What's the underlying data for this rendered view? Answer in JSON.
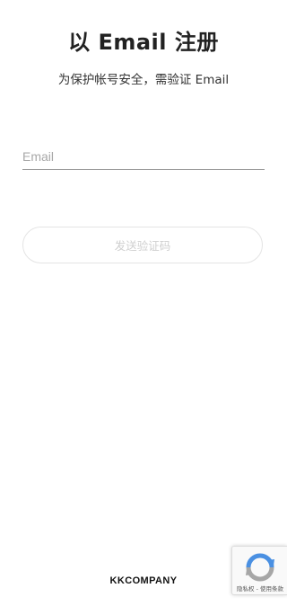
{
  "header": {
    "title": "以 Email 注册",
    "subtitle": "为保护帐号安全，需验证 Email"
  },
  "form": {
    "email_placeholder": "Email",
    "email_value": "",
    "send_button_label": "发送验证码"
  },
  "footer": {
    "brand": "KKCOMPANY"
  },
  "recaptcha": {
    "icon": "recaptcha-icon",
    "privacy_label": "隐私权",
    "separator": " - ",
    "terms_label": "使用条款"
  },
  "colors": {
    "text_primary": "#222222",
    "placeholder": "#a8a8a8",
    "button_disabled_text": "#cfcfcf",
    "button_border": "#e4e4e4",
    "underline": "#9a9a9a",
    "recaptcha_blue": "#4a90e2",
    "recaptcha_gray": "#a6a6a6"
  }
}
